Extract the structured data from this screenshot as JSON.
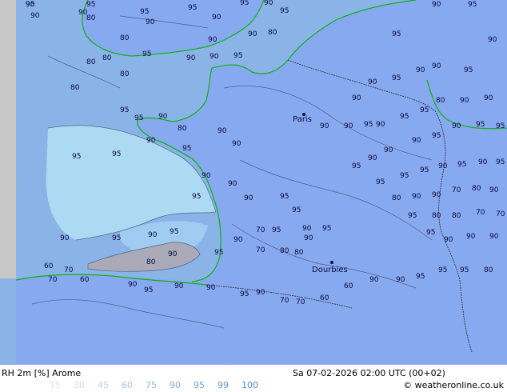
{
  "product": {
    "parameter": "RH 2m [%]",
    "model": "Arome",
    "valid_time": "Sa 07-02-2026 02:00 UTC (00+02)",
    "credit": "© weatheronline.co.uk"
  },
  "legend": {
    "values": [
      "15",
      "30",
      "45",
      "60",
      "75",
      "90",
      "95",
      "99",
      "100"
    ],
    "colors": [
      "#dbeaf8",
      "#c9def4",
      "#b5d2f0",
      "#a3c7ec",
      "#90bce8",
      "#7eb0e4",
      "#6aa3e0",
      "#5b97d9",
      "#4f8ad2"
    ]
  },
  "map": {
    "ocean_color": "#8ab4e8",
    "land_color": "#8aaef0",
    "low_rh_color": "#b2e0f5",
    "cities": [
      {
        "name": "Paris"
      },
      {
        "name": "Dourbies"
      }
    ],
    "contour_labels": [
      "90",
      "95",
      "90",
      "90",
      "95",
      "95",
      "95",
      "90",
      "95",
      "90",
      "90",
      "80",
      "80",
      "90",
      "90",
      "80",
      "80",
      "80",
      "80",
      "80",
      "90",
      "90",
      "95",
      "95",
      "95",
      "95",
      "90",
      "80",
      "90",
      "90",
      "90",
      "95",
      "95",
      "95",
      "90",
      "95",
      "90",
      "90",
      "95",
      "95",
      "70",
      "95",
      "90",
      "95",
      "90",
      "80",
      "80",
      "70",
      "90",
      "95",
      "95",
      "90",
      "95",
      "90",
      "90",
      "80",
      "60",
      "70",
      "60",
      "70",
      "90",
      "95",
      "90",
      "90",
      "95",
      "90",
      "70",
      "70",
      "60",
      "60",
      "90",
      "90",
      "95",
      "95",
      "95",
      "80",
      "90",
      "90",
      "90",
      "95",
      "95",
      "80",
      "80",
      "70",
      "70",
      "80",
      "90",
      "90",
      "70",
      "80",
      "90",
      "95",
      "95",
      "95",
      "90",
      "95",
      "90",
      "95",
      "95",
      "90",
      "90",
      "90",
      "95",
      "90",
      "95",
      "95",
      "90",
      "90",
      "95",
      "90",
      "95",
      "95",
      "80",
      "90",
      "90",
      "90",
      "90",
      "95",
      "90",
      "90",
      "95",
      "90",
      "95",
      "90",
      "95",
      "95"
    ]
  }
}
